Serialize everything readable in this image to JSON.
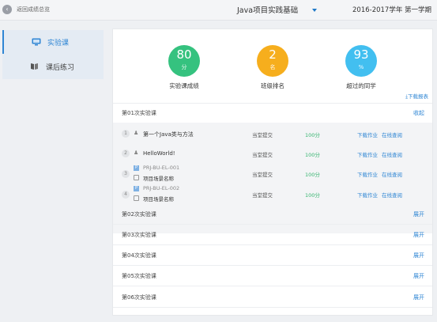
{
  "topbar": {
    "back_icon": "chevron-left-icon",
    "back_label": "返回成绩总览",
    "course": "Java项目实践基础",
    "term": "2016-2017学年 第一学期"
  },
  "sidebar": {
    "items": [
      {
        "label": "实验课",
        "icon": "monitor-icon",
        "active": true
      },
      {
        "label": "课后练习",
        "icon": "book-icon",
        "active": false
      }
    ]
  },
  "stats": [
    {
      "value": "80",
      "unit": "分",
      "label": "实验课成绩",
      "color": "#35c27f"
    },
    {
      "value": "2",
      "unit": "名",
      "label": "班级排名",
      "color": "#f6ae1d"
    },
    {
      "value": "93",
      "unit": "%",
      "label": "超过的同学",
      "color": "#42bff0"
    }
  ],
  "download_report": "下载报表",
  "sections": [
    {
      "title": "第01次实验课",
      "action": "收起"
    },
    {
      "title": "第02次实验课",
      "action": "展开"
    },
    {
      "title": "第03次实验课",
      "action": "展开"
    },
    {
      "title": "第04次实验课",
      "action": "展开"
    },
    {
      "title": "第05次实验课",
      "action": "展开"
    },
    {
      "title": "第06次实验课",
      "action": "展开"
    }
  ],
  "rows": [
    {
      "index": "1",
      "title": "第一个Java类与方法",
      "status": "当堂提交",
      "score": "100分",
      "download": "下载作业",
      "view": "在线查阅"
    },
    {
      "index": "2",
      "title": "HelloWorld!",
      "status": "当堂提交",
      "score": "100分",
      "download": "下载作业",
      "view": "在线查阅"
    },
    {
      "index": "3",
      "code": "PRJ-BU-EL-001",
      "subtitle": "项目场景名称",
      "status": "当堂提交",
      "score": "100分",
      "download": "下载作业",
      "view": "在线查阅"
    },
    {
      "index": "4",
      "code": "PRJ-BU-EL-002",
      "subtitle": "项目场景名称",
      "status": "当堂提交",
      "score": "100分",
      "download": "下载作业",
      "view": "在线查阅"
    }
  ]
}
